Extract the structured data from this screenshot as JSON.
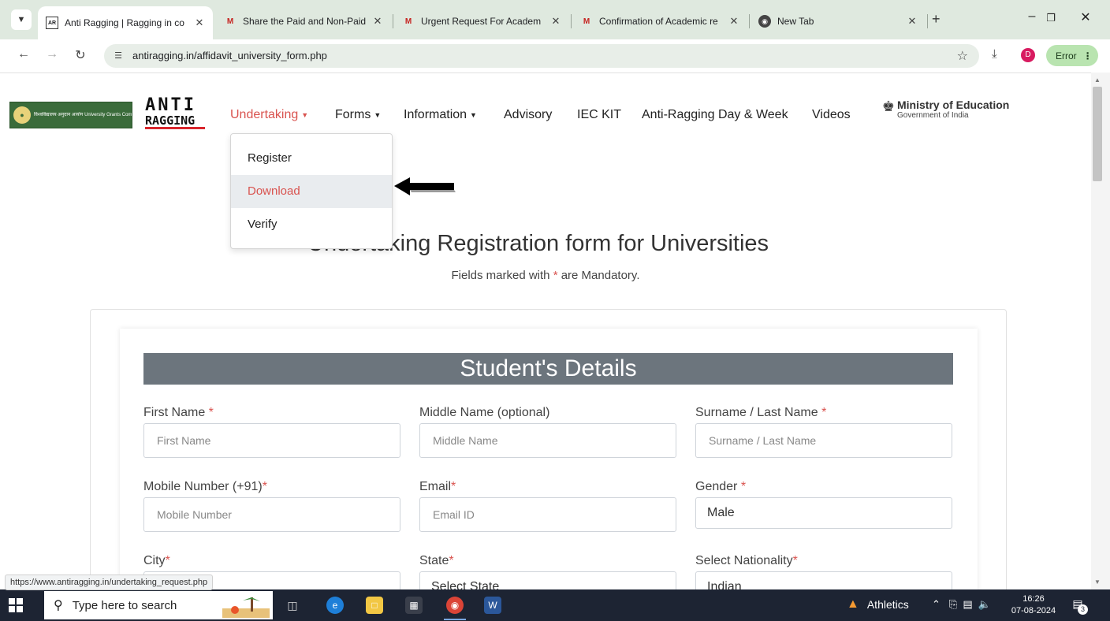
{
  "browser": {
    "tabs": [
      {
        "title": "Anti Ragging | Ragging in co",
        "icon": "anti-ragging-favicon"
      },
      {
        "title": "Share the Paid and Non-Paid",
        "icon": "gmail-icon"
      },
      {
        "title": "Urgent Request For Academ",
        "icon": "gmail-icon"
      },
      {
        "title": "Confirmation of Academic re",
        "icon": "gmail-icon"
      },
      {
        "title": "New Tab",
        "icon": "chrome-icon"
      }
    ],
    "new_tab_symbol": "+",
    "url": "antiragging.in/affidavit_university_form.php",
    "profile_initial": "D",
    "error_label": "Error"
  },
  "site": {
    "ugc_logo_text": "विश्वविद्यालय अनुदान आयोग University Grants Commission quality higher education for all",
    "anti_ragging_logo_line1": "ANTI",
    "anti_ragging_logo_line2": "RAGGING",
    "nav": [
      {
        "label": "Undertaking",
        "has_caret": true
      },
      {
        "label": "Forms",
        "has_caret": true
      },
      {
        "label": "Information",
        "has_caret": true
      },
      {
        "label": "Advisory",
        "has_caret": false
      },
      {
        "label": "IEC KIT",
        "has_caret": false
      },
      {
        "label": "Anti-Ragging Day & Week",
        "has_caret": false
      },
      {
        "label": "Videos",
        "has_caret": false
      }
    ],
    "ministry_title": "Ministry of Education",
    "ministry_subtitle": "Government of India",
    "dropdown_items": [
      {
        "label": "Register"
      },
      {
        "label": "Download"
      },
      {
        "label": "Verify"
      }
    ]
  },
  "form": {
    "title": "Undertaking Registration form for Universities",
    "mandatory_prefix": "Fields marked with ",
    "mandatory_star": "*",
    "mandatory_suffix": " are Mandatory.",
    "section_title": "Student's Details",
    "fields": {
      "first_name": {
        "label": "First Name ",
        "required": "*",
        "placeholder": "First Name"
      },
      "middle_name": {
        "label": "Middle Name (optional)",
        "required": "",
        "placeholder": "Middle Name"
      },
      "surname": {
        "label": "Surname / Last Name ",
        "required": "*",
        "placeholder": "Surname / Last Name"
      },
      "mobile": {
        "label": "Mobile Number (+91)",
        "required": "*",
        "placeholder": "Mobile Number"
      },
      "email": {
        "label": "Email",
        "required": "*",
        "placeholder": "Email ID"
      },
      "gender": {
        "label": "Gender ",
        "required": "*",
        "value": "Male"
      },
      "city": {
        "label": "City",
        "required": "*"
      },
      "state": {
        "label": "State",
        "required": "*",
        "value": "Select State"
      },
      "nationality": {
        "label": "Select Nationality",
        "required": "*",
        "value": "Indian"
      }
    }
  },
  "status_bar_url": "https://www.antiragging.in/undertaking_request.php",
  "taskbar": {
    "search_placeholder": "Type here to search",
    "weather_label": "Athletics",
    "time": "16:26",
    "date": "07-08-2024",
    "notification_count": "3"
  },
  "colors": {
    "accent_red": "#d9534f",
    "section_header_bg": "#6c757d",
    "tabstrip_bg": "#dfe9df",
    "taskbar_bg": "#1d2433"
  }
}
